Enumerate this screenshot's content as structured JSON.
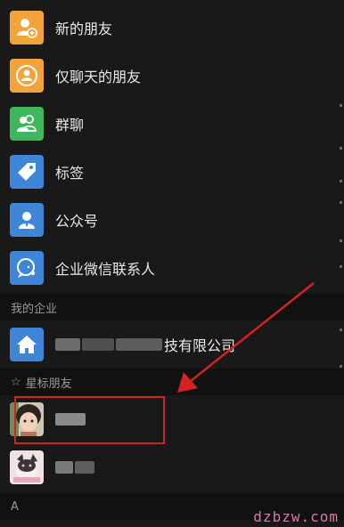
{
  "contacts_menu": {
    "items": [
      {
        "label": "新的朋友",
        "icon": "add-friend-icon",
        "color": "#f2a33a"
      },
      {
        "label": "仅聊天的朋友",
        "icon": "chat-only-friend-icon",
        "color": "#f2a33a"
      },
      {
        "label": "群聊",
        "icon": "group-chat-icon",
        "color": "#3fb75c"
      },
      {
        "label": "标签",
        "icon": "tag-icon",
        "color": "#3f86d9"
      },
      {
        "label": "公众号",
        "icon": "official-account-icon",
        "color": "#3f86d9"
      },
      {
        "label": "企业微信联系人",
        "icon": "wecom-contact-icon",
        "color": "#3f86d9"
      }
    ]
  },
  "enterprise_section": {
    "title": "我的企业",
    "company_label_visible": "技有限公司",
    "icon": "home-icon",
    "icon_color": "#3f86d9"
  },
  "starred_section": {
    "title": "星标朋友",
    "icon": "star-icon"
  },
  "section_a": {
    "title": "A"
  },
  "annotation": {
    "color": "#d42222"
  },
  "watermark": "dzbzw.com"
}
